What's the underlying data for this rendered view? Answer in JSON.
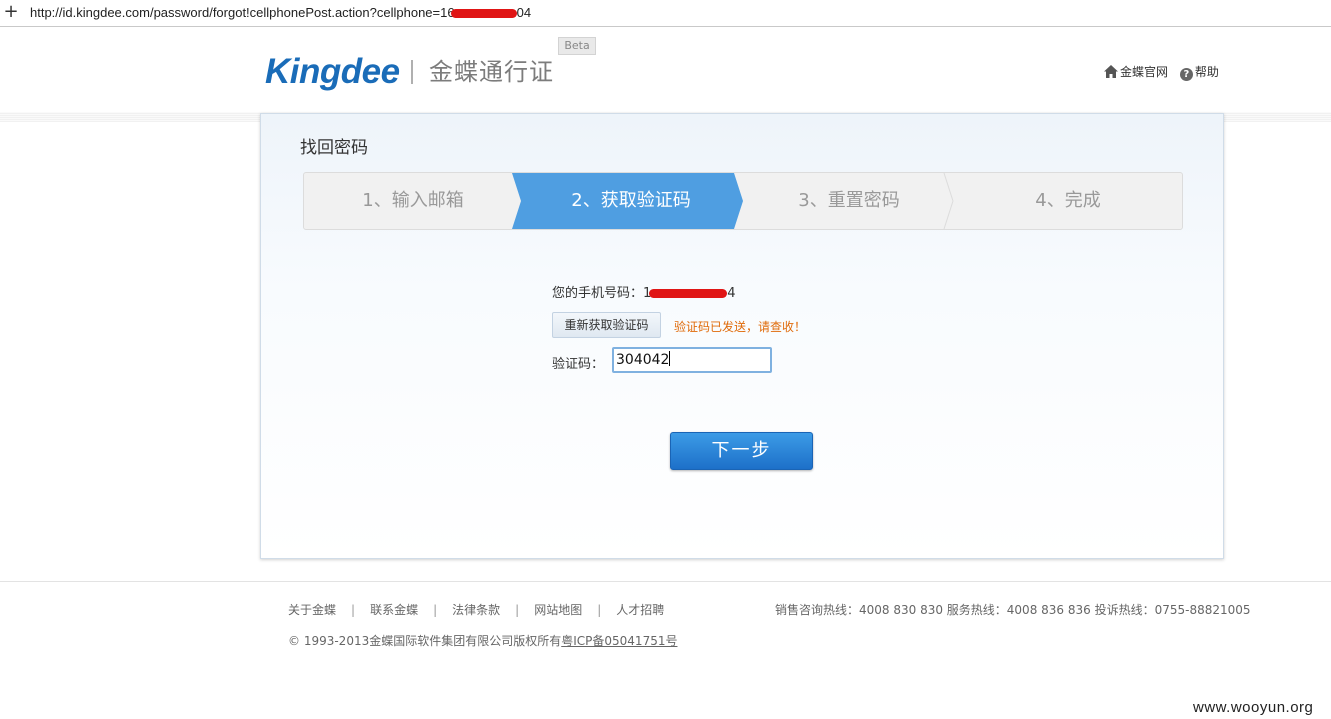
{
  "browser": {
    "new_tab_symbol": "+",
    "url_prefix": "http://id.kingdee.com/password/forgot!cellphonePost.action?cellphone=",
    "url_visible_head": "16",
    "url_visible_tail": "04"
  },
  "header": {
    "logo_text": "Kingdee",
    "logo_subtitle": "金蝶通行证",
    "beta_badge": "Beta",
    "links": [
      {
        "icon": "home-icon",
        "label": "金蝶官网"
      },
      {
        "icon": "help-icon",
        "label": "帮助"
      }
    ],
    "help_glyph": "?"
  },
  "card": {
    "title": "找回密码",
    "steps": [
      {
        "label": "1、输入邮箱",
        "active": false
      },
      {
        "label": "2、获取验证码",
        "active": true
      },
      {
        "label": "3、重置密码",
        "active": false
      },
      {
        "label": "4、完成",
        "active": false
      }
    ],
    "phone_label": "您的手机号码：",
    "phone_visible_head": "1",
    "phone_visible_tail": "4",
    "resend_button": "重新获取验证码",
    "sent_message": "验证码已发送，请查收！",
    "code_label": "验证码：",
    "code_value": "304042",
    "next_button": "下一步"
  },
  "colors": {
    "brand": "#1a6cb8",
    "step_active": "#4f9ee1",
    "warning": "#e06b0a",
    "redaction": "#e01515"
  },
  "footer": {
    "links": [
      "关于金蝶",
      "联系金蝶",
      "法律条款",
      "网站地图",
      "人才招聘"
    ],
    "separator": "|",
    "hotline": "销售咨询热线：4008 830 830 服务热线：4008 836 836 投诉热线：0755-88821005",
    "copyright": "© 1993-2013金蝶国际软件集团有限公司版权所有",
    "icp": "粤ICP备05041751号"
  },
  "watermark": "www.wooyun.org"
}
